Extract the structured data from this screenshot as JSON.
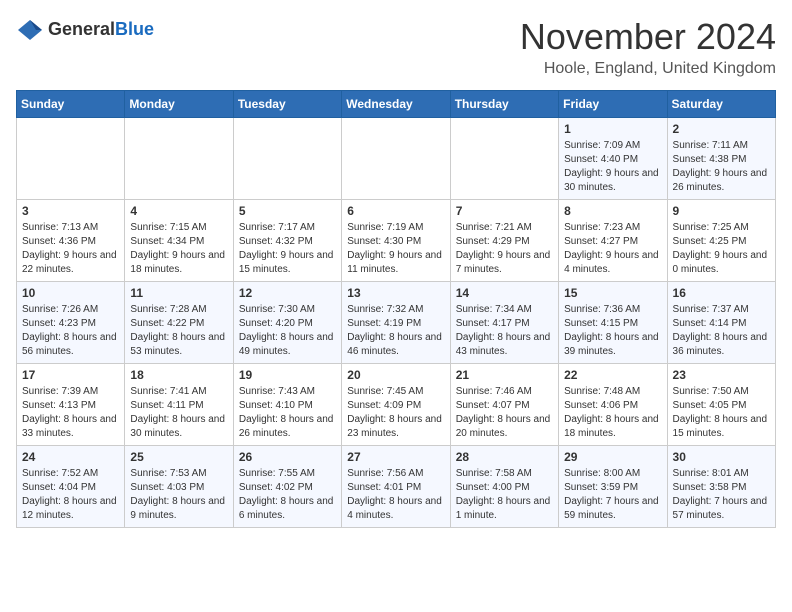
{
  "logo": {
    "general": "General",
    "blue": "Blue"
  },
  "header": {
    "month": "November 2024",
    "location": "Hoole, England, United Kingdom"
  },
  "weekdays": [
    "Sunday",
    "Monday",
    "Tuesday",
    "Wednesday",
    "Thursday",
    "Friday",
    "Saturday"
  ],
  "weeks": [
    [
      {
        "day": "",
        "info": ""
      },
      {
        "day": "",
        "info": ""
      },
      {
        "day": "",
        "info": ""
      },
      {
        "day": "",
        "info": ""
      },
      {
        "day": "",
        "info": ""
      },
      {
        "day": "1",
        "info": "Sunrise: 7:09 AM\nSunset: 4:40 PM\nDaylight: 9 hours and 30 minutes."
      },
      {
        "day": "2",
        "info": "Sunrise: 7:11 AM\nSunset: 4:38 PM\nDaylight: 9 hours and 26 minutes."
      }
    ],
    [
      {
        "day": "3",
        "info": "Sunrise: 7:13 AM\nSunset: 4:36 PM\nDaylight: 9 hours and 22 minutes."
      },
      {
        "day": "4",
        "info": "Sunrise: 7:15 AM\nSunset: 4:34 PM\nDaylight: 9 hours and 18 minutes."
      },
      {
        "day": "5",
        "info": "Sunrise: 7:17 AM\nSunset: 4:32 PM\nDaylight: 9 hours and 15 minutes."
      },
      {
        "day": "6",
        "info": "Sunrise: 7:19 AM\nSunset: 4:30 PM\nDaylight: 9 hours and 11 minutes."
      },
      {
        "day": "7",
        "info": "Sunrise: 7:21 AM\nSunset: 4:29 PM\nDaylight: 9 hours and 7 minutes."
      },
      {
        "day": "8",
        "info": "Sunrise: 7:23 AM\nSunset: 4:27 PM\nDaylight: 9 hours and 4 minutes."
      },
      {
        "day": "9",
        "info": "Sunrise: 7:25 AM\nSunset: 4:25 PM\nDaylight: 9 hours and 0 minutes."
      }
    ],
    [
      {
        "day": "10",
        "info": "Sunrise: 7:26 AM\nSunset: 4:23 PM\nDaylight: 8 hours and 56 minutes."
      },
      {
        "day": "11",
        "info": "Sunrise: 7:28 AM\nSunset: 4:22 PM\nDaylight: 8 hours and 53 minutes."
      },
      {
        "day": "12",
        "info": "Sunrise: 7:30 AM\nSunset: 4:20 PM\nDaylight: 8 hours and 49 minutes."
      },
      {
        "day": "13",
        "info": "Sunrise: 7:32 AM\nSunset: 4:19 PM\nDaylight: 8 hours and 46 minutes."
      },
      {
        "day": "14",
        "info": "Sunrise: 7:34 AM\nSunset: 4:17 PM\nDaylight: 8 hours and 43 minutes."
      },
      {
        "day": "15",
        "info": "Sunrise: 7:36 AM\nSunset: 4:15 PM\nDaylight: 8 hours and 39 minutes."
      },
      {
        "day": "16",
        "info": "Sunrise: 7:37 AM\nSunset: 4:14 PM\nDaylight: 8 hours and 36 minutes."
      }
    ],
    [
      {
        "day": "17",
        "info": "Sunrise: 7:39 AM\nSunset: 4:13 PM\nDaylight: 8 hours and 33 minutes."
      },
      {
        "day": "18",
        "info": "Sunrise: 7:41 AM\nSunset: 4:11 PM\nDaylight: 8 hours and 30 minutes."
      },
      {
        "day": "19",
        "info": "Sunrise: 7:43 AM\nSunset: 4:10 PM\nDaylight: 8 hours and 26 minutes."
      },
      {
        "day": "20",
        "info": "Sunrise: 7:45 AM\nSunset: 4:09 PM\nDaylight: 8 hours and 23 minutes."
      },
      {
        "day": "21",
        "info": "Sunrise: 7:46 AM\nSunset: 4:07 PM\nDaylight: 8 hours and 20 minutes."
      },
      {
        "day": "22",
        "info": "Sunrise: 7:48 AM\nSunset: 4:06 PM\nDaylight: 8 hours and 18 minutes."
      },
      {
        "day": "23",
        "info": "Sunrise: 7:50 AM\nSunset: 4:05 PM\nDaylight: 8 hours and 15 minutes."
      }
    ],
    [
      {
        "day": "24",
        "info": "Sunrise: 7:52 AM\nSunset: 4:04 PM\nDaylight: 8 hours and 12 minutes."
      },
      {
        "day": "25",
        "info": "Sunrise: 7:53 AM\nSunset: 4:03 PM\nDaylight: 8 hours and 9 minutes."
      },
      {
        "day": "26",
        "info": "Sunrise: 7:55 AM\nSunset: 4:02 PM\nDaylight: 8 hours and 6 minutes."
      },
      {
        "day": "27",
        "info": "Sunrise: 7:56 AM\nSunset: 4:01 PM\nDaylight: 8 hours and 4 minutes."
      },
      {
        "day": "28",
        "info": "Sunrise: 7:58 AM\nSunset: 4:00 PM\nDaylight: 8 hours and 1 minute."
      },
      {
        "day": "29",
        "info": "Sunrise: 8:00 AM\nSunset: 3:59 PM\nDaylight: 7 hours and 59 minutes."
      },
      {
        "day": "30",
        "info": "Sunrise: 8:01 AM\nSunset: 3:58 PM\nDaylight: 7 hours and 57 minutes."
      }
    ]
  ]
}
